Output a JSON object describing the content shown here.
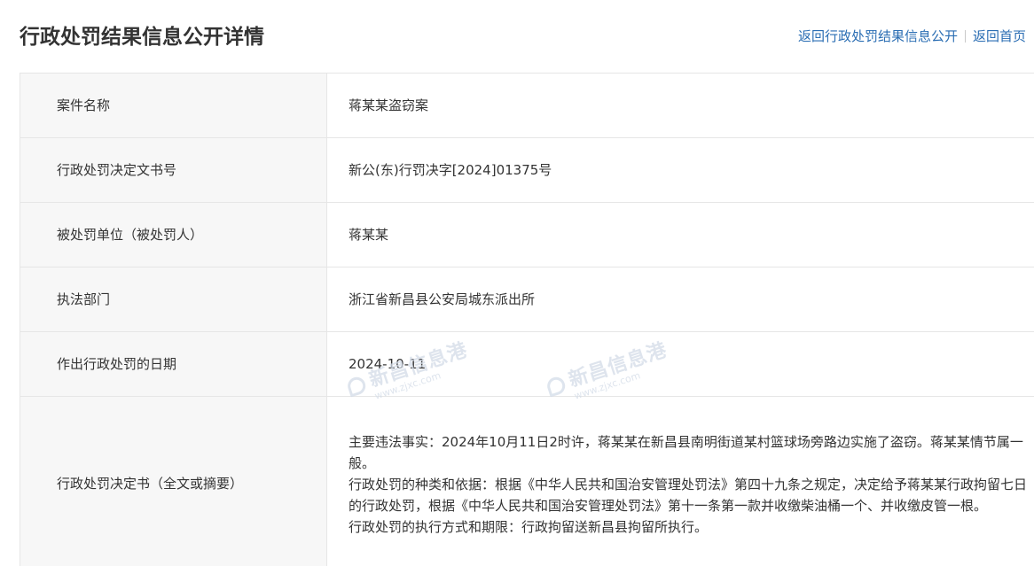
{
  "header": {
    "title": "行政处罚结果信息公开详情",
    "links": [
      {
        "label": "返回行政处罚结果信息公开"
      },
      {
        "label": "返回首页"
      }
    ]
  },
  "details": {
    "case_name": {
      "label": "案件名称",
      "value": "蒋某某盗窃案"
    },
    "document_no": {
      "label": "行政处罚决定文书号",
      "value": "新公(东)行罚决字[2024]01375号"
    },
    "penalized_party": {
      "label": "被处罚单位（被处罚人）",
      "value": "蒋某某"
    },
    "enforcement_dept": {
      "label": "执法部门",
      "value": "浙江省新昌县公安局城东派出所"
    },
    "decision_date": {
      "label": "作出行政处罚的日期",
      "value": "2024-10-11"
    },
    "decision_text": {
      "label": "行政处罚决定书（全文或摘要）",
      "paragraphs": [
        "主要违法事实：2024年10月11日2时许，蒋某某在新昌县南明街道某村篮球场旁路边实施了盗窃。蒋某某情节属一般。",
        "行政处罚的种类和依据：根据《中华人民共和国治安管理处罚法》第四十九条之规定，决定给予蒋某某行政拘留七日的行政处罚，根据《中华人民共和国治安管理处罚法》第十一条第一款并收缴柴油桶一个、并收缴皮管一根。",
        "行政处罚的执行方式和期限：行政拘留送新昌县拘留所执行。"
      ]
    }
  },
  "watermark": {
    "text": "新昌信息港",
    "url": "www.zjxc.com"
  },
  "colors": {
    "link": "#2a6db3",
    "label_bg": "#f7f7f7",
    "border": "#e6e6e6",
    "text": "#333333"
  }
}
